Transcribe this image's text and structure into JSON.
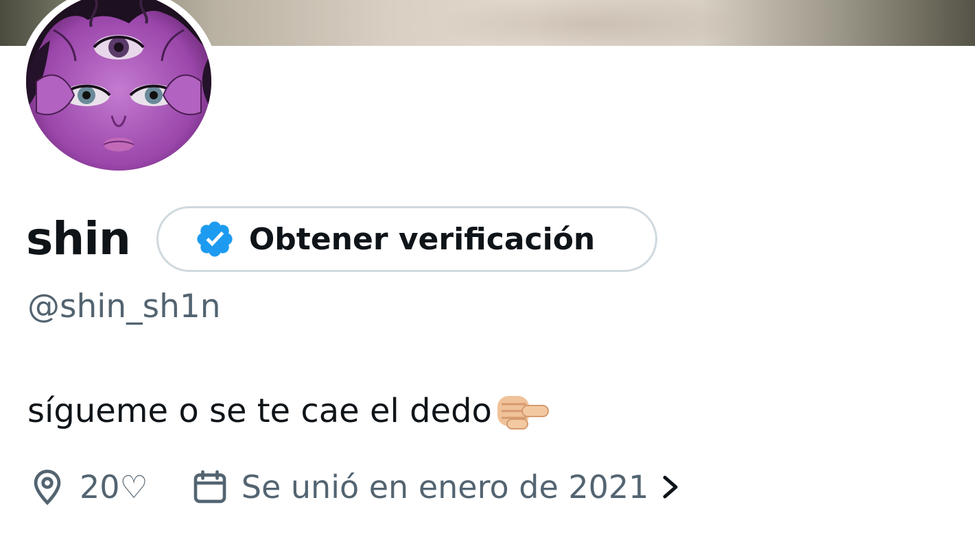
{
  "profile": {
    "display_name": "shin",
    "handle": "@shin_sh1n",
    "bio": "sígueme o se te cae el dedo",
    "bio_emoji": "pointing-finger-emoji",
    "location": "20♡",
    "joined": "Se unió en enero de 2021"
  },
  "verification": {
    "label": "Obtener verificación",
    "icon": "verified-badge-icon"
  },
  "icons": {
    "location": "location-pin-icon",
    "calendar": "calendar-icon",
    "chevron": "chevron-right-icon"
  },
  "colors": {
    "text_primary": "#0f1419",
    "text_secondary": "#536471",
    "verified_blue": "#1d9bf0",
    "border": "#cfd9de",
    "avatar_purple": "#a04bb0"
  }
}
